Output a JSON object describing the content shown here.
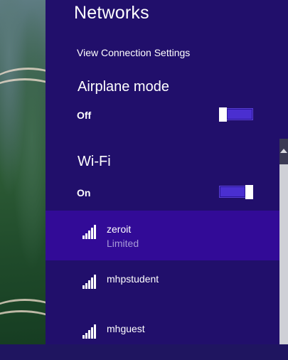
{
  "panel": {
    "title": "Networks",
    "view_connection_settings": "View Connection Settings"
  },
  "airplane_mode": {
    "title": "Airplane mode",
    "state": "Off",
    "on": false
  },
  "wifi": {
    "title": "Wi-Fi",
    "state": "On",
    "on": true
  },
  "networks": [
    {
      "name": "zeroit",
      "status": "Limited",
      "selected": true,
      "signal_bars": 5
    },
    {
      "name": "mhpstudent",
      "status": "",
      "selected": false,
      "signal_bars": 5
    },
    {
      "name": "mhguest",
      "status": "",
      "selected": false,
      "signal_bars": 5
    }
  ],
  "colors": {
    "panel_bg": "#210f6b",
    "selected_bg": "#320b97",
    "toggle_fill": "#4a2fd0",
    "status_text": "#a79ad8"
  }
}
